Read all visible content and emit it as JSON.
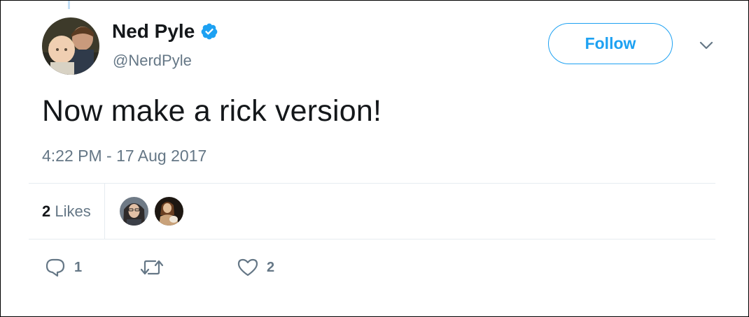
{
  "author": {
    "display_name": "Ned Pyle",
    "handle": "@NerdPyle",
    "verified": true
  },
  "follow_button": {
    "label": "Follow"
  },
  "tweet": {
    "text": "Now make a rick version!",
    "timestamp": "4:22 PM - 17 Aug 2017"
  },
  "stats": {
    "likes_count": "2",
    "likes_label": "Likes"
  },
  "actions": {
    "reply_count": "1",
    "retweet_count": "",
    "like_count": "2"
  },
  "colors": {
    "accent": "#1da1f2",
    "secondary_text": "#657786",
    "divider": "#e6ecf0"
  },
  "icons": {
    "verified": "verified-badge-icon",
    "more": "chevron-down-icon",
    "reply": "reply-icon",
    "retweet": "retweet-icon",
    "like": "heart-icon"
  }
}
